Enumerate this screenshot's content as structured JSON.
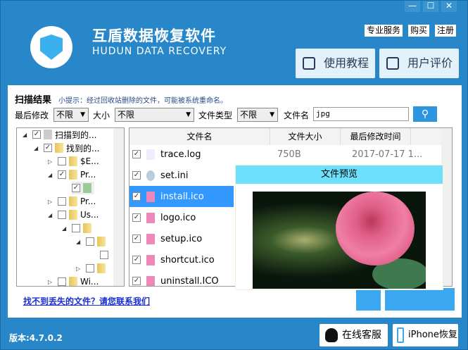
{
  "window": {
    "minimize": "—",
    "maximize": "☐",
    "close": "✕"
  },
  "header": {
    "app_name": "互盾数据恢复软件",
    "app_name_en": "HUDUN DATA RECOVERY",
    "links": [
      "专业服务",
      "购买",
      "注册"
    ],
    "tutorial": "使用教程",
    "reviews": "用户评价"
  },
  "scan": {
    "title": "扫描结果",
    "tip": "小提示：经过回收站删除的文件，可能被系统重命名。"
  },
  "filters": {
    "modified_label": "最后修改",
    "modified_value": "不限",
    "size_label": "大小",
    "size_value": "不限",
    "type_label": "文件类型",
    "type_value": "不限",
    "name_label": "文件名",
    "name_value": "jpg"
  },
  "tree": [
    {
      "label": "扫描到的..."
    },
    {
      "label": "找到的..."
    },
    {
      "label": "$E..."
    },
    {
      "label": "Pr..."
    },
    {
      "label": ""
    },
    {
      "label": "Pr..."
    },
    {
      "label": "Us..."
    },
    {
      "label": ""
    },
    {
      "label": ""
    },
    {
      "label": ""
    },
    {
      "label": ""
    },
    {
      "label": "Wi..."
    }
  ],
  "columns": {
    "name": "文件名",
    "size": "文件大小",
    "modified": "最后修改时间"
  },
  "files": [
    {
      "name": "trace.log",
      "size": "750B",
      "modified": "2017-07-17 1..."
    },
    {
      "name": "set.ini"
    },
    {
      "name": "install.ico"
    },
    {
      "name": "logo.ico"
    },
    {
      "name": "setup.ico"
    },
    {
      "name": "shortcut.ico"
    },
    {
      "name": "uninstall.ICO"
    }
  ],
  "preview": {
    "title": "文件预览"
  },
  "help_link": "找不到丢失的文件？请您联系我们",
  "version": "版本:4.7.0.2",
  "footer": {
    "support": "在线客服",
    "iphone": "iPhone恢复"
  }
}
